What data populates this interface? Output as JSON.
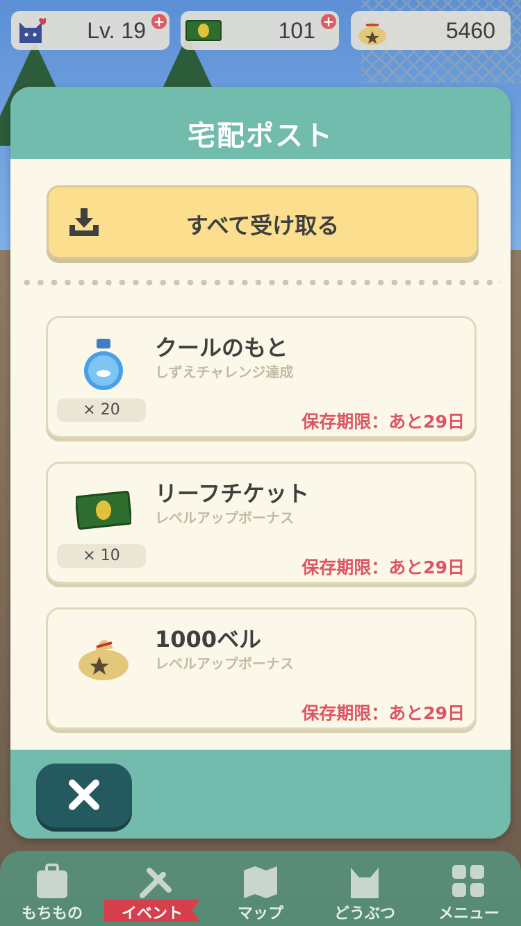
{
  "status_bar": {
    "level_label": "Lv. 19",
    "leaf_tickets": "101",
    "bells": "5460"
  },
  "modal": {
    "title": "宅配ポスト",
    "receive_all_label": "すべて受け取る",
    "items": [
      {
        "name": "クールのもと",
        "source": "しずえチャレンジ達成",
        "quantity": "× 20",
        "expiry": "保存期限：あと29日",
        "icon": "potion-bottle-icon"
      },
      {
        "name": "リーフチケット",
        "source": "レベルアップボーナス",
        "quantity": "× 10",
        "expiry": "保存期限：あと29日",
        "icon": "leaf-ticket-icon"
      },
      {
        "name": "1000ベル",
        "source": "レベルアップボーナス",
        "quantity": "",
        "expiry": "保存期限：あと29日",
        "icon": "bell-bag-icon"
      }
    ],
    "close_icon": "close-icon"
  },
  "nav": {
    "items": [
      {
        "label": "もちもの",
        "icon": "bag-icon"
      },
      {
        "label": "イベント",
        "icon": "tools-icon",
        "active": true
      },
      {
        "label": "マップ",
        "icon": "map-icon"
      },
      {
        "label": "どうぶつ",
        "icon": "animal-icon"
      },
      {
        "label": "メニュー",
        "icon": "menu-grid-icon"
      }
    ]
  },
  "colors": {
    "header_teal": "#71bcad",
    "receive_button": "#fbdf8f",
    "expiry_red": "#dc5562",
    "close_button": "#245960",
    "active_ribbon": "#d6404d"
  }
}
